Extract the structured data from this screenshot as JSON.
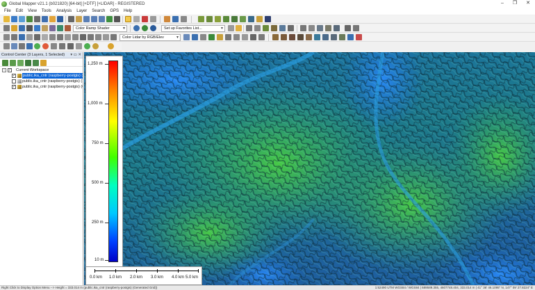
{
  "window": {
    "title": "Global Mapper v21.1 (b021820) [64-bit] [+DTF] [+LIDAR] - REGISTERED",
    "controls": [
      "–",
      "❐",
      "✕"
    ]
  },
  "menubar": [
    "File",
    "Edit",
    "View",
    "Tools",
    "Analysis",
    "Layer",
    "Search",
    "GPS",
    "Help"
  ],
  "toolbar": {
    "shader_select": "Color Ramp Shader",
    "favorites_select": "Set up Favorites List...",
    "lidar_color_select": "Color Lidar by RGB/Elev"
  },
  "control_center": {
    "title": "Control Center (3 Layers, 1 Selected)",
    "workspace_label": "Current Workspace",
    "layers": [
      {
        "name": "public.ika_cntr (raspberry-postgis) (Generated Grid)",
        "checked": true,
        "selected": true
      },
      {
        "name": "public.ika_cntr (raspberry-postgis) (10,423...",
        "checked": false,
        "selected": false
      },
      {
        "name": "public.ika_cntr (raspberry-postgis) (Generated...",
        "checked": true,
        "selected": false
      }
    ]
  },
  "legend": {
    "labels": [
      "1,250 m",
      "1,000 m",
      "750 m",
      "500 m",
      "250 m",
      "10 m"
    ],
    "colors": [
      "#ff0000",
      "#ff8000",
      "#ffff00",
      "#40ff00",
      "#00ffc0",
      "#00c8ff",
      "#0040ff",
      "#0000c8"
    ]
  },
  "scalebar": {
    "labels": [
      "0.0 km",
      "1.0 km",
      "2.0 km",
      "3.0 km",
      "4.0 km",
      "5.0 km"
    ]
  },
  "status": {
    "left": "Right Click to Display Option Menu --> Height = 333.014 m (public.ika_cntr (raspberry-postgis) (Generated Grid))",
    "right": "1:52490  UTM WGS84 / WGS84 | 689589.355, 4607748.404, 333.014 m | 41° 36' 46.1095\" N, 147° 09' 27.8224\" E"
  }
}
